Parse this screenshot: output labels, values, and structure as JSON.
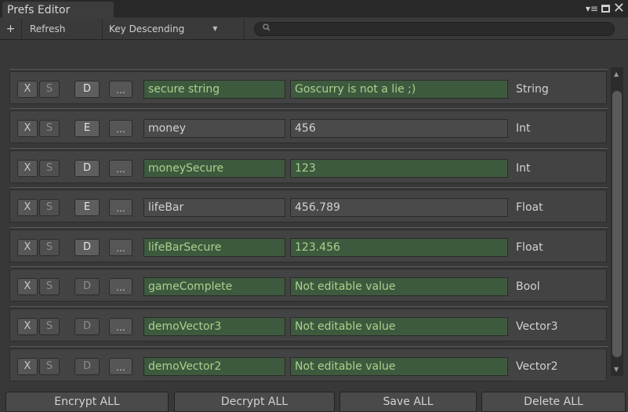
{
  "window": {
    "tab_title": "Prefs Editor",
    "controls": {
      "menu": "▾≡",
      "maximize": "",
      "close": "✕"
    }
  },
  "toolbar": {
    "add_label": "+",
    "refresh_label": "Refresh",
    "sort_label": "Key Descending",
    "sort_arrow": "▼",
    "search_icon": "🔍"
  },
  "rows": [
    {
      "x": "X",
      "s": "S",
      "mode": "D",
      "more": "...",
      "key": "secure string",
      "value": "Goscurry is not a lie ;)",
      "type": "String"
    },
    {
      "x": "X",
      "s": "S",
      "mode": "E",
      "more": "...",
      "key": "money",
      "value": "456",
      "type": "Int"
    },
    {
      "x": "X",
      "s": "S",
      "mode": "D",
      "more": "...",
      "key": "moneySecure",
      "value": "123",
      "type": "Int"
    },
    {
      "x": "X",
      "s": "S",
      "mode": "E",
      "more": "...",
      "key": "lifeBar",
      "value": "456.789",
      "type": "Float"
    },
    {
      "x": "X",
      "s": "S",
      "mode": "D",
      "more": "...",
      "key": "lifeBarSecure",
      "value": "123.456",
      "type": "Float"
    },
    {
      "x": "X",
      "s": "S",
      "mode": "D",
      "more": "...",
      "key": "gameComplete",
      "value": "Not editable value",
      "type": "Bool"
    },
    {
      "x": "X",
      "s": "S",
      "mode": "D",
      "more": "...",
      "key": "demoVector3",
      "value": "Not editable value",
      "type": "Vector3"
    },
    {
      "x": "X",
      "s": "S",
      "mode": "D",
      "more": "...",
      "key": "demoVector2",
      "value": "Not editable value",
      "type": "Vector2"
    }
  ],
  "bottom": {
    "encrypt_all": "Encrypt ALL",
    "decrypt_all": "Decrypt ALL",
    "save_all": "Save ALL",
    "delete_all": "Delete ALL"
  }
}
